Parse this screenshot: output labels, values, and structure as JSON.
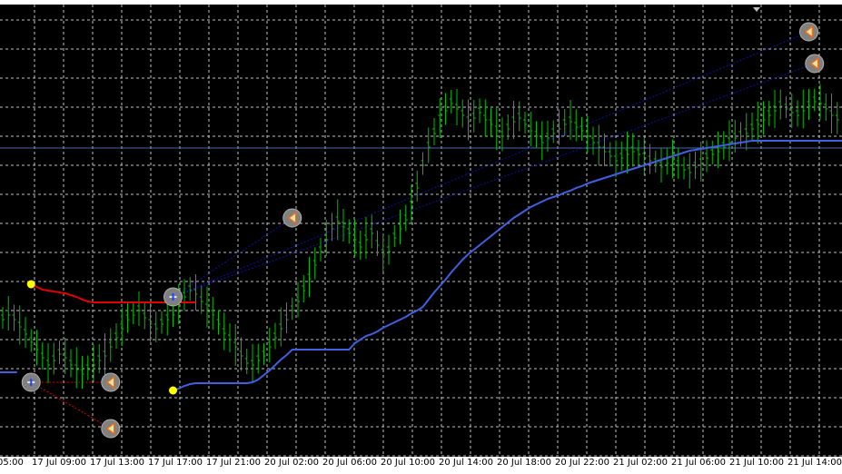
{
  "chart_data": {
    "type": "line",
    "title": "",
    "xlabel": "",
    "ylabel": "",
    "grid": true,
    "colors": {
      "background": "#000000",
      "grid": "#c0c0c0",
      "bars": "#00c000",
      "indicator_up": "#4060e0",
      "indicator_down": "#e00000",
      "trendline": "#1010a0",
      "marker_dot": "#ffff00",
      "horizontal_line": "#4a6aa8",
      "arrow_marker": "#808080"
    },
    "x_tick_labels": [
      "05:00",
      "17 Jul 09:00",
      "17 Jul 13:00",
      "17 Jul 17:00",
      "17 Jul 21:00",
      "20 Jul 02:00",
      "20 Jul 06:00",
      "20 Jul 10:00",
      "20 Jul 14:00",
      "20 Jul 18:00",
      "20 Jul 22:00",
      "21 Jul 02:00",
      "21 Jul 06:00",
      "21 Jul 10:00",
      "21 Jul 14:00"
    ],
    "bar_count": 148,
    "price_close": [
      350,
      345,
      350,
      358,
      366,
      375,
      383,
      392,
      400,
      395,
      388,
      392,
      400,
      405,
      410,
      405,
      400,
      395,
      390,
      380,
      370,
      360,
      350,
      345,
      340,
      348,
      355,
      360,
      355,
      350,
      345,
      335,
      325,
      318,
      322,
      330,
      338,
      345,
      355,
      365,
      372,
      380,
      390,
      398,
      400,
      395,
      390,
      380,
      370,
      360,
      350,
      340,
      330,
      318,
      305,
      290,
      275,
      262,
      250,
      242,
      248,
      255,
      262,
      270,
      262,
      255,
      268,
      278,
      275,
      260,
      250,
      240,
      225,
      205,
      180,
      160,
      145,
      130,
      120,
      112,
      118,
      125,
      132,
      128,
      122,
      130,
      135,
      142,
      148,
      140,
      132,
      128,
      135,
      142,
      148,
      155,
      150,
      145,
      140,
      135,
      132,
      138,
      142,
      148,
      155,
      160,
      165,
      170,
      175,
      172,
      168,
      165,
      168,
      172,
      175,
      178,
      182,
      178,
      175,
      180,
      185,
      188,
      182,
      178,
      172,
      168,
      165,
      160,
      155,
      150,
      148,
      145,
      140,
      135,
      130,
      125,
      120,
      115,
      118,
      122,
      125,
      120,
      115,
      110,
      112,
      118,
      125,
      130
    ],
    "series": [
      {
        "style": "red-segment",
        "values": [
          313,
          316,
          319,
          320,
          321,
          322,
          323,
          325,
          327,
          330,
          332,
          333,
          333,
          333,
          333,
          333,
          333,
          333,
          333,
          333,
          333,
          333,
          333,
          333,
          333,
          333,
          333,
          333,
          333,
          333
        ]
      },
      {
        "style": "blue-segment",
        "values": [
          410,
          410,
          410,
          410,
          430,
          428,
          425,
          423,
          422,
          422,
          422,
          422,
          422,
          422,
          422,
          422,
          422,
          422,
          421,
          418,
          413,
          408,
          402,
          396,
          391,
          385,
          385,
          385,
          385,
          385,
          385,
          385,
          385,
          385,
          385,
          385,
          378,
          374,
          370,
          368,
          365,
          361,
          358,
          355,
          352,
          349,
          345,
          342,
          338,
          330,
          322,
          315,
          308,
          300,
          293,
          286,
          280,
          275,
          270,
          265,
          260,
          255,
          250,
          245,
          240,
          236,
          232,
          228,
          225,
          222,
          219,
          217,
          215,
          212,
          210,
          207,
          205,
          202,
          200,
          198,
          196,
          194,
          192,
          190,
          188,
          186,
          184,
          182,
          180,
          178,
          176,
          174,
          172,
          170,
          168,
          166,
          165,
          164,
          163,
          162,
          161,
          160,
          159,
          158,
          157,
          156,
          155,
          155,
          155,
          155,
          155,
          155,
          155,
          155,
          155,
          155,
          155,
          155,
          155,
          155,
          155,
          155,
          155,
          155,
          155,
          155,
          155,
          155,
          155,
          155,
          155,
          155,
          155,
          155,
          155,
          155,
          155,
          155,
          155,
          155
        ]
      }
    ],
    "annotations": [
      {
        "kind": "dot",
        "x": 5,
        "y": 313
      },
      {
        "kind": "dot",
        "x": 30,
        "y": 430
      },
      {
        "kind": "buy-arrow",
        "x": 5,
        "y": 421
      },
      {
        "kind": "sell-arrow",
        "x": 19,
        "y": 421
      },
      {
        "kind": "sell-arrow",
        "x": 19,
        "y": 472
      },
      {
        "kind": "buy-arrow",
        "x": 30,
        "y": 327
      },
      {
        "kind": "sell-arrow",
        "x": 51,
        "y": 240
      },
      {
        "kind": "sell-arrow",
        "x": 142,
        "y": 35
      },
      {
        "kind": "sell-arrow",
        "x": 143,
        "y": 70
      }
    ]
  }
}
